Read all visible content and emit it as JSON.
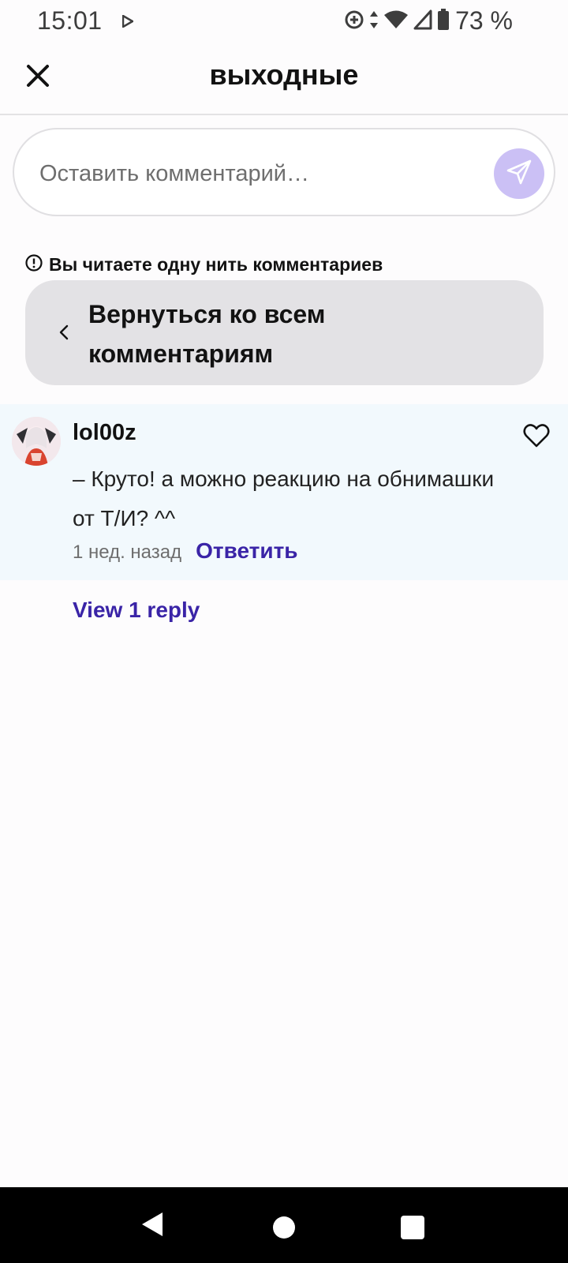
{
  "status_bar": {
    "time": "15:01",
    "battery": "73 %",
    "icons": [
      "play-icon",
      "data-saver-icon",
      "data-arrows-icon",
      "wifi-icon",
      "signal-icon",
      "battery-icon"
    ]
  },
  "header": {
    "title": "выходные",
    "close_icon": "close-icon"
  },
  "comment_input": {
    "placeholder": "Оставить комментарий…",
    "send_icon": "send-icon",
    "send_color": "#cbc0f5"
  },
  "thread": {
    "notice": "Вы читаете одну нить комментариев",
    "back_label": "Вернуться ко всем комментариям"
  },
  "comment": {
    "username": "lol00z",
    "text": "– Круто! а можно реакцию на обнимашки от Т/И? ^^",
    "time": "1 нед. назад",
    "reply_label": "Ответить",
    "highlight_color": "#f2f9fd"
  },
  "view_replies": "View 1 reply",
  "colors": {
    "accent": "#3a24a7",
    "text": "#121212",
    "muted": "#6e6e6e"
  }
}
